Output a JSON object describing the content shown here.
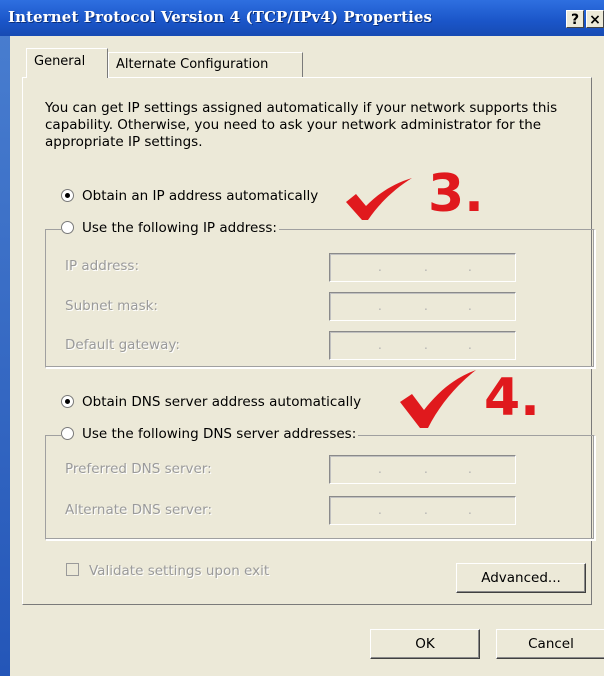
{
  "window": {
    "title": "Internet Protocol Version 4 (TCP/IPv4) Properties",
    "help_label": "?",
    "close_label": "×"
  },
  "tabs": [
    {
      "label": "General",
      "active": true
    },
    {
      "label": "Alternate Configuration",
      "active": false
    }
  ],
  "intro_text": "You can get IP settings assigned automatically if your network supports this capability. Otherwise, you need to ask your network administrator for the appropriate IP settings.",
  "ip": {
    "auto_label": "Obtain an IP address automatically",
    "auto_selected": true,
    "manual_label": "Use the following IP address:",
    "fields": [
      {
        "label": "IP address:",
        "value": ". . ."
      },
      {
        "label": "Subnet mask:",
        "value": ". . ."
      },
      {
        "label": "Default gateway:",
        "value": ". . ."
      }
    ]
  },
  "dns": {
    "auto_label": "Obtain DNS server address automatically",
    "auto_selected": true,
    "manual_label": "Use the following DNS server addresses:",
    "fields": [
      {
        "label": "Preferred DNS server:",
        "value": ". . ."
      },
      {
        "label": "Alternate DNS server:",
        "value": ". . ."
      }
    ]
  },
  "validate_label": "Validate settings upon exit",
  "buttons": {
    "advanced": "Advanced...",
    "ok": "OK",
    "cancel": "Cancel"
  },
  "annotations": {
    "step3": "3.",
    "step4": "4.",
    "color": "#e0191d"
  }
}
